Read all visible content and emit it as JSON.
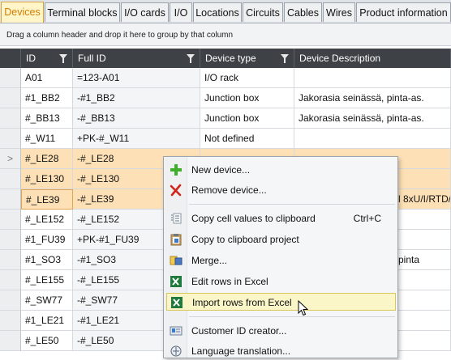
{
  "tabs": [
    "Devices",
    "Terminal blocks",
    "I/O cards",
    "I/O",
    "Locations",
    "Circuits",
    "Cables",
    "Wires",
    "Product information"
  ],
  "group_panel_text": "Drag a column header and drop it here to group by that column",
  "columns": [
    "ID",
    "Full ID",
    "Device type",
    "Device Description"
  ],
  "rows": [
    {
      "id": "A01",
      "full_id": "=123-A01",
      "type": "I/O rack",
      "desc": ""
    },
    {
      "id": "#1_BB2",
      "full_id": "-#1_BB2",
      "type": "Junction box",
      "desc": "Jakorasia seinässä, pinta-as."
    },
    {
      "id": "#_BB13",
      "full_id": "-#_BB13",
      "type": "Junction box",
      "desc": "Jakorasia seinässä, pinta-as."
    },
    {
      "id": "#_W11",
      "full_id": "+PK-#_W11",
      "type": "Not defined",
      "desc": ""
    },
    {
      "id": "#_LE28",
      "full_id": "-#_LE28",
      "type": "",
      "desc": ""
    },
    {
      "id": "#_LE130",
      "full_id": "-#_LE130",
      "type": "",
      "desc": ""
    },
    {
      "id": "#_LE39",
      "full_id": "-#_LE39",
      "type": "",
      "desc": "l 8xU/I/RTD/"
    },
    {
      "id": "#_LE152",
      "full_id": "-#_LE152",
      "type": "",
      "desc": ""
    },
    {
      "id": "#1_FU39",
      "full_id": "+PK-#1_FU39",
      "type": "",
      "desc": ""
    },
    {
      "id": "#1_SO3",
      "full_id": "-#1_SO3",
      "type": "",
      "desc": "pinta"
    },
    {
      "id": "#_LE155",
      "full_id": "-#_LE155",
      "type": "",
      "desc": ""
    },
    {
      "id": "#_SW77",
      "full_id": "-#_SW77",
      "type": "",
      "desc": ""
    },
    {
      "id": "#1_LE21",
      "full_id": "-#1_LE21",
      "type": "",
      "desc": ""
    },
    {
      "id": "#_LE50",
      "full_id": "-#_LE50",
      "type": "",
      "desc": ""
    }
  ],
  "row_indicator": ">",
  "menu": {
    "new_device": "New device...",
    "remove_device": "Remove device...",
    "copy_cells": "Copy cell values to clipboard",
    "copy_cells_shortcut": "Ctrl+C",
    "copy_project": "Copy to clipboard project",
    "merge": "Merge...",
    "edit_excel": "Edit rows in Excel",
    "import_excel": "Import rows from Excel",
    "customer_id": "Customer ID creator...",
    "language": "Language translation..."
  },
  "colors": {
    "active_tab_bg": "#fff5c8",
    "active_tab_text": "#d27f00",
    "selection": "#fde0b6",
    "header_bg": "#3e4247",
    "menu_highlight": "#fbf6c7"
  }
}
